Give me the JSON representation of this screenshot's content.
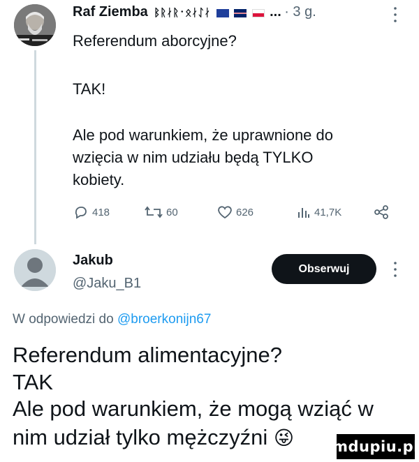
{
  "tweet1": {
    "author_name": "Raf Ziemba",
    "runes": "ᛒᚱᛅᚱ᛫ᛟᛅᛇᛅ",
    "ellipsis": "...",
    "time": "· 3 g.",
    "line1": "Referendum aborcyjne?",
    "line2": "TAK!",
    "line3": "Ale pod warunkiem, że uprawnione do",
    "line4": "wzięcia w nim udziału będą TYLKO",
    "line5": "kobiety.",
    "stats": {
      "replies": "418",
      "retweets": "60",
      "likes": "626",
      "views": "41,7K"
    }
  },
  "tweet2": {
    "author_name": "Jakub",
    "handle": "@Jaku_B1",
    "follow_label": "Obserwuj",
    "reply_prefix": "W odpowiedzi do",
    "reply_to": "@broerkonijn67",
    "line1": "Referendum alimentacyjne?",
    "line2": "TAK",
    "line3": "Ale pod warunkiem, że mogą wziąć w",
    "line4": "nim udział tylko mężczyźni",
    "emoji": "😜"
  },
  "watermark": "mdupiu.pl",
  "colors": {
    "text": "#0f1419",
    "muted": "#536471",
    "link": "#1d9bf0",
    "button": "#0f1419",
    "thread_line": "#cfd9de"
  },
  "icons": [
    "reply-icon",
    "retweet-icon",
    "like-icon",
    "views-icon",
    "share-icon",
    "more-icon"
  ]
}
